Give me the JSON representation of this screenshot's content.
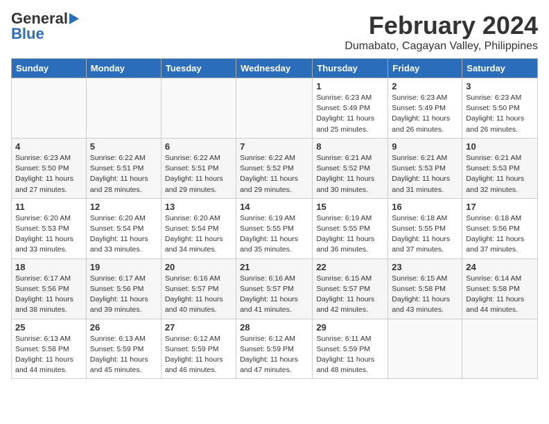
{
  "logo": {
    "general": "General",
    "blue": "Blue"
  },
  "title": {
    "month": "February 2024",
    "location": "Dumabato, Cagayan Valley, Philippines"
  },
  "headers": [
    "Sunday",
    "Monday",
    "Tuesday",
    "Wednesday",
    "Thursday",
    "Friday",
    "Saturday"
  ],
  "weeks": [
    [
      {
        "day": "",
        "info": ""
      },
      {
        "day": "",
        "info": ""
      },
      {
        "day": "",
        "info": ""
      },
      {
        "day": "",
        "info": ""
      },
      {
        "day": "1",
        "info": "Sunrise: 6:23 AM\nSunset: 5:49 PM\nDaylight: 11 hours and 25 minutes."
      },
      {
        "day": "2",
        "info": "Sunrise: 6:23 AM\nSunset: 5:49 PM\nDaylight: 11 hours and 26 minutes."
      },
      {
        "day": "3",
        "info": "Sunrise: 6:23 AM\nSunset: 5:50 PM\nDaylight: 11 hours and 26 minutes."
      }
    ],
    [
      {
        "day": "4",
        "info": "Sunrise: 6:23 AM\nSunset: 5:50 PM\nDaylight: 11 hours and 27 minutes."
      },
      {
        "day": "5",
        "info": "Sunrise: 6:22 AM\nSunset: 5:51 PM\nDaylight: 11 hours and 28 minutes."
      },
      {
        "day": "6",
        "info": "Sunrise: 6:22 AM\nSunset: 5:51 PM\nDaylight: 11 hours and 29 minutes."
      },
      {
        "day": "7",
        "info": "Sunrise: 6:22 AM\nSunset: 5:52 PM\nDaylight: 11 hours and 29 minutes."
      },
      {
        "day": "8",
        "info": "Sunrise: 6:21 AM\nSunset: 5:52 PM\nDaylight: 11 hours and 30 minutes."
      },
      {
        "day": "9",
        "info": "Sunrise: 6:21 AM\nSunset: 5:53 PM\nDaylight: 11 hours and 31 minutes."
      },
      {
        "day": "10",
        "info": "Sunrise: 6:21 AM\nSunset: 5:53 PM\nDaylight: 11 hours and 32 minutes."
      }
    ],
    [
      {
        "day": "11",
        "info": "Sunrise: 6:20 AM\nSunset: 5:53 PM\nDaylight: 11 hours and 33 minutes."
      },
      {
        "day": "12",
        "info": "Sunrise: 6:20 AM\nSunset: 5:54 PM\nDaylight: 11 hours and 33 minutes."
      },
      {
        "day": "13",
        "info": "Sunrise: 6:20 AM\nSunset: 5:54 PM\nDaylight: 11 hours and 34 minutes."
      },
      {
        "day": "14",
        "info": "Sunrise: 6:19 AM\nSunset: 5:55 PM\nDaylight: 11 hours and 35 minutes."
      },
      {
        "day": "15",
        "info": "Sunrise: 6:19 AM\nSunset: 5:55 PM\nDaylight: 11 hours and 36 minutes."
      },
      {
        "day": "16",
        "info": "Sunrise: 6:18 AM\nSunset: 5:55 PM\nDaylight: 11 hours and 37 minutes."
      },
      {
        "day": "17",
        "info": "Sunrise: 6:18 AM\nSunset: 5:56 PM\nDaylight: 11 hours and 37 minutes."
      }
    ],
    [
      {
        "day": "18",
        "info": "Sunrise: 6:17 AM\nSunset: 5:56 PM\nDaylight: 11 hours and 38 minutes."
      },
      {
        "day": "19",
        "info": "Sunrise: 6:17 AM\nSunset: 5:56 PM\nDaylight: 11 hours and 39 minutes."
      },
      {
        "day": "20",
        "info": "Sunrise: 6:16 AM\nSunset: 5:57 PM\nDaylight: 11 hours and 40 minutes."
      },
      {
        "day": "21",
        "info": "Sunrise: 6:16 AM\nSunset: 5:57 PM\nDaylight: 11 hours and 41 minutes."
      },
      {
        "day": "22",
        "info": "Sunrise: 6:15 AM\nSunset: 5:57 PM\nDaylight: 11 hours and 42 minutes."
      },
      {
        "day": "23",
        "info": "Sunrise: 6:15 AM\nSunset: 5:58 PM\nDaylight: 11 hours and 43 minutes."
      },
      {
        "day": "24",
        "info": "Sunrise: 6:14 AM\nSunset: 5:58 PM\nDaylight: 11 hours and 44 minutes."
      }
    ],
    [
      {
        "day": "25",
        "info": "Sunrise: 6:13 AM\nSunset: 5:58 PM\nDaylight: 11 hours and 44 minutes."
      },
      {
        "day": "26",
        "info": "Sunrise: 6:13 AM\nSunset: 5:59 PM\nDaylight: 11 hours and 45 minutes."
      },
      {
        "day": "27",
        "info": "Sunrise: 6:12 AM\nSunset: 5:59 PM\nDaylight: 11 hours and 46 minutes."
      },
      {
        "day": "28",
        "info": "Sunrise: 6:12 AM\nSunset: 5:59 PM\nDaylight: 11 hours and 47 minutes."
      },
      {
        "day": "29",
        "info": "Sunrise: 6:11 AM\nSunset: 5:59 PM\nDaylight: 11 hours and 48 minutes."
      },
      {
        "day": "",
        "info": ""
      },
      {
        "day": "",
        "info": ""
      }
    ]
  ]
}
